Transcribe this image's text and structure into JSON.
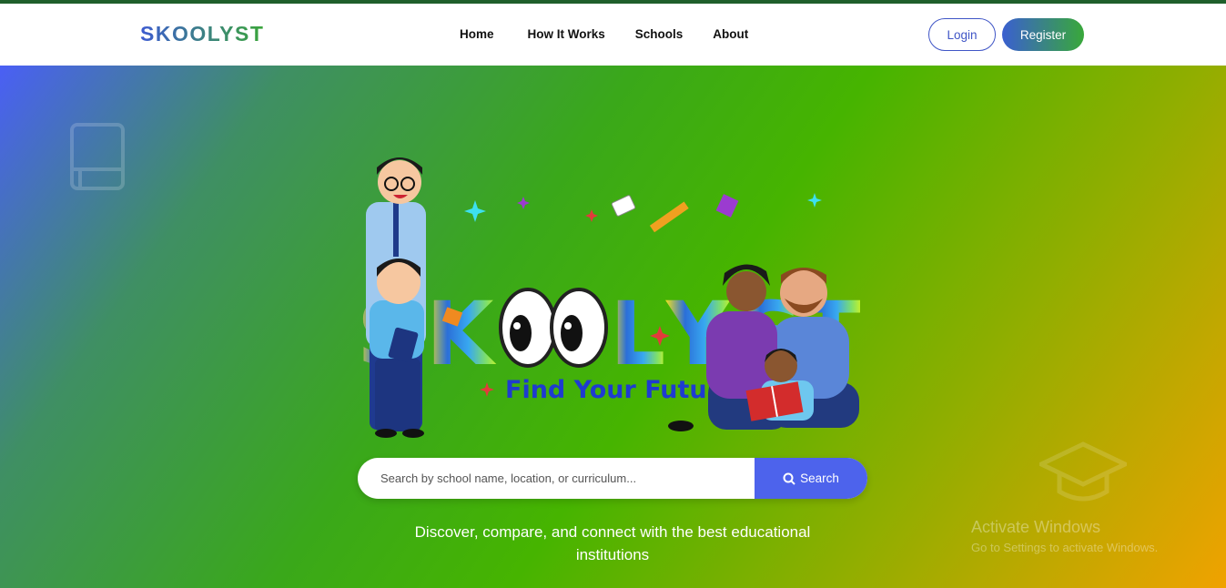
{
  "brand": {
    "logo_text": "SKOOLYST"
  },
  "nav": {
    "items": [
      {
        "label": "Home"
      },
      {
        "label": "How It Works"
      },
      {
        "label": "Schools"
      },
      {
        "label": "About"
      }
    ]
  },
  "auth": {
    "login_label": "Login",
    "register_label": "Register"
  },
  "hero": {
    "illustration": {
      "logo_text": "SKOOLYST",
      "slogan": "Find Your Futur"
    },
    "search": {
      "placeholder": "Search by school name, location, or curriculum...",
      "button_label": "Search",
      "button_icon": "search-icon"
    },
    "tagline": "Discover, compare, and connect with the best educational institutions"
  },
  "watermark": {
    "title": "Activate Windows",
    "subtitle": "Go to Settings to activate Windows."
  },
  "colors": {
    "accent_blue": "#4d63ec",
    "brand_green": "#3aa53a",
    "top_bar": "#1f5f2b"
  }
}
